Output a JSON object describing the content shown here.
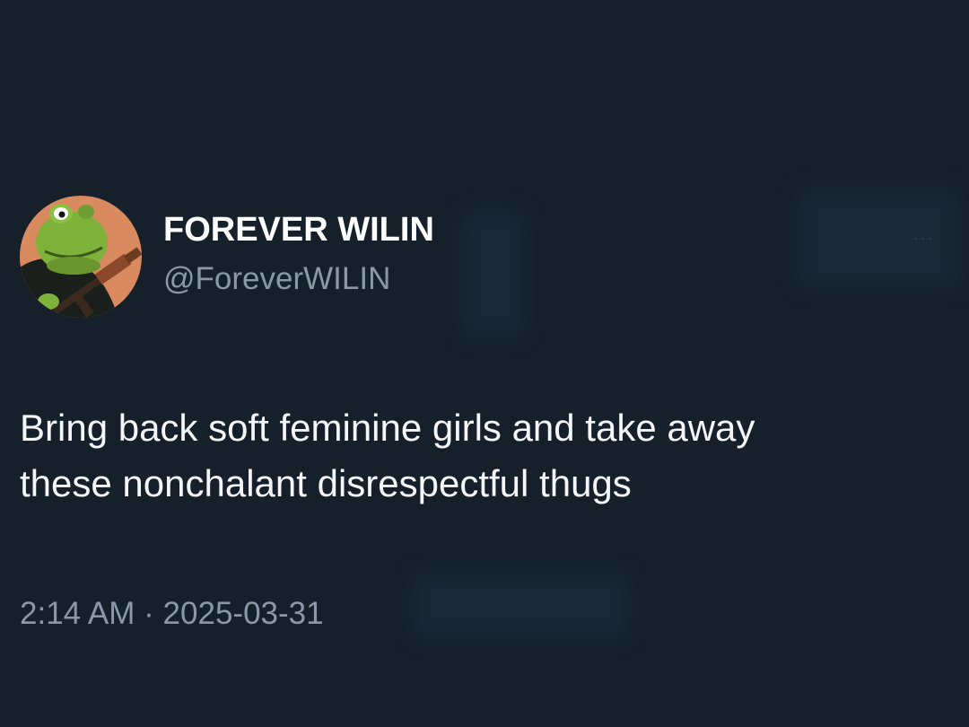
{
  "theme": {
    "background": "#15202b",
    "text_primary": "#ffffff",
    "text_secondary": "#8b98a5"
  },
  "author": {
    "display_name": "FOREVER WILIN",
    "handle": "@ForeverWILIN",
    "avatar_icon": "frog-with-rifle-avatar"
  },
  "tweet": {
    "text": "Bring back soft feminine girls and take away\nthese nonchalant disrespectful thugs",
    "time": "2:14 AM",
    "separator": "·",
    "date": "2025-03-31"
  },
  "more_button": {
    "icon": "more-dots-icon",
    "label": "···"
  }
}
